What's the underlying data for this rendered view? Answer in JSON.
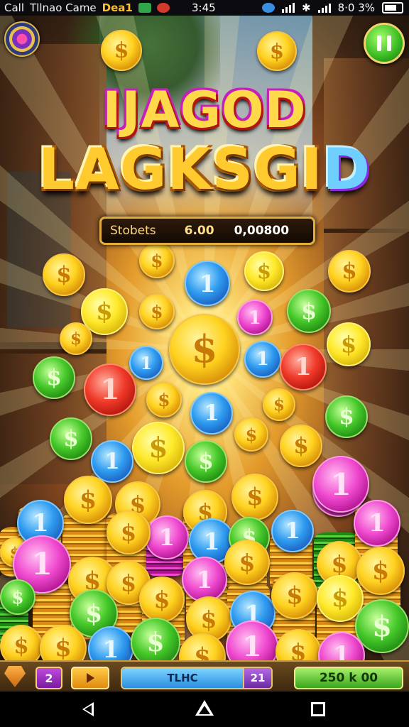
{
  "status_bar": {
    "left_text_1": "Call",
    "left_text_2": "Tllnao Came",
    "left_text_3": "Dea1",
    "time": "3:45",
    "right_text": "8·0 3%"
  },
  "game": {
    "title_line_1": "IJAGOD",
    "title_line_2_main": "LAGKSGI",
    "title_line_2_accent": "D",
    "score_panel": {
      "label": "Stobets",
      "value_1": "6.00",
      "value_2": "0,00800"
    },
    "pause_button_icon": "pause-icon",
    "logo_icon": "gem-medallion-icon",
    "coin_glyphs": {
      "dollar": "$",
      "one": "1"
    }
  },
  "hud": {
    "chest_icon": "chest-icon",
    "level_badge": "2",
    "play_icon": "play-icon",
    "progress_label": "TLHC",
    "progress_fraction": 0.82,
    "progress_count": "21",
    "coin_total": "250 k 00"
  },
  "nav_bar": {
    "back_icon": "back-icon",
    "home_icon": "home-icon",
    "recent_icon": "recent-apps-icon"
  },
  "colors": {
    "gold": "#ffd21f",
    "green": "#46c92a",
    "blue": "#2f9cf0",
    "red": "#f03a2a",
    "pink": "#f04ad0",
    "hud_bg": "#3b260d"
  }
}
